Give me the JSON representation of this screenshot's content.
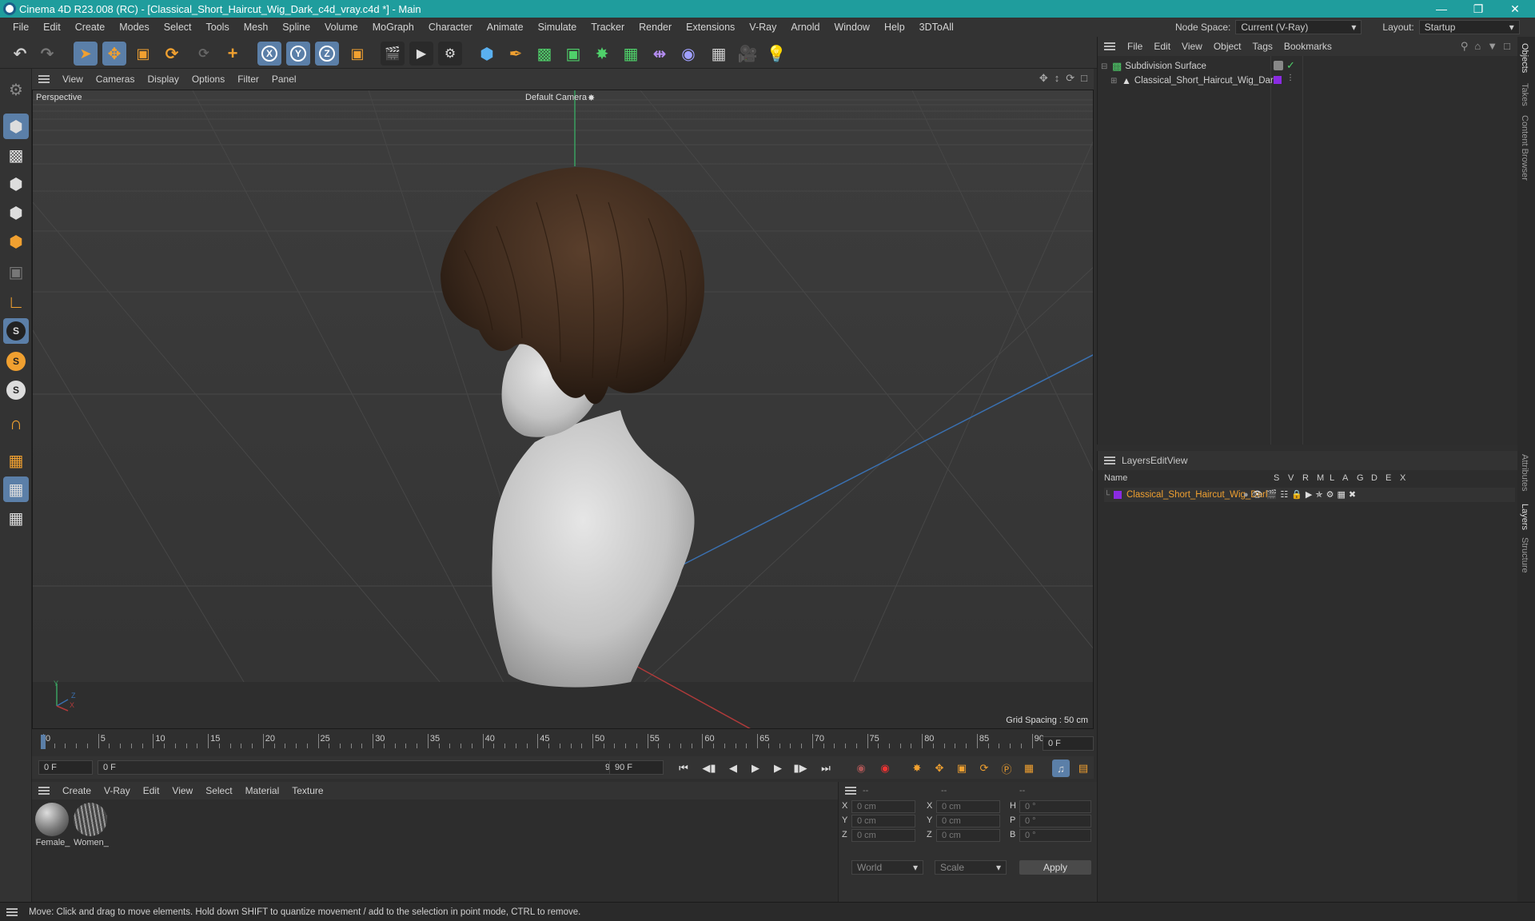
{
  "window": {
    "title": "Cinema 4D R23.008 (RC) - [Classical_Short_Haircut_Wig_Dark_c4d_vray.c4d *] - Main"
  },
  "menu": [
    "File",
    "Edit",
    "Create",
    "Modes",
    "Select",
    "Tools",
    "Mesh",
    "Spline",
    "Volume",
    "MoGraph",
    "Character",
    "Animate",
    "Simulate",
    "Tracker",
    "Render",
    "Extensions",
    "V-Ray",
    "Arnold",
    "Window",
    "Help",
    "3DToAll"
  ],
  "node_space": {
    "label": "Node Space:",
    "value": "Current (V-Ray)"
  },
  "layout": {
    "label": "Layout:",
    "value": "Startup"
  },
  "toolbar_axes": [
    "X",
    "Y",
    "Z"
  ],
  "viewport": {
    "menu": [
      "View",
      "Cameras",
      "Display",
      "Options",
      "Filter",
      "Panel"
    ],
    "name": "Perspective",
    "camera": "Default Camera",
    "grid_spacing": "Grid Spacing : 50 cm",
    "axis_labels": {
      "y": "Y",
      "z": "Z",
      "x": "X"
    }
  },
  "timeline": {
    "ticks": [
      "0",
      "5",
      "10",
      "15",
      "20",
      "25",
      "30",
      "35",
      "40",
      "45",
      "50",
      "55",
      "60",
      "65",
      "70",
      "75",
      "80",
      "85",
      "90"
    ],
    "current_frame": "0 F",
    "start": "0 F",
    "range_start": "0 F",
    "range_end": "90 F",
    "end": "90 F"
  },
  "material_menu": [
    "Create",
    "V-Ray",
    "Edit",
    "View",
    "Select",
    "Material",
    "Texture"
  ],
  "materials": [
    {
      "name": "Female_"
    },
    {
      "name": "Women_"
    }
  ],
  "coords": {
    "header": [
      "--",
      "--",
      "--"
    ],
    "rows": [
      {
        "a": "X",
        "v1": "0 cm",
        "b": "X",
        "v2": "0 cm",
        "c": "H",
        "v3": "0 °"
      },
      {
        "a": "Y",
        "v1": "0 cm",
        "b": "Y",
        "v2": "0 cm",
        "c": "P",
        "v3": "0 °"
      },
      {
        "a": "Z",
        "v1": "0 cm",
        "b": "Z",
        "v2": "0 cm",
        "c": "B",
        "v3": "0 °"
      }
    ],
    "world": "World",
    "scale": "Scale",
    "apply": "Apply"
  },
  "objects": {
    "menu": [
      "File",
      "Edit",
      "View",
      "Object",
      "Tags",
      "Bookmarks"
    ],
    "items": [
      {
        "name": "Subdivision Surface"
      },
      {
        "name": "Classical_Short_Haircut_Wig_Dark"
      }
    ]
  },
  "layers": {
    "menu": [
      "Layers",
      "Edit",
      "View"
    ],
    "columns": [
      "Name",
      "S",
      "V",
      "R",
      "M",
      "L",
      "A",
      "G",
      "D",
      "E",
      "X"
    ],
    "items": [
      {
        "name": "Classical_Short_Haircut_Wig_Dark",
        "color": "#8a2be2"
      }
    ]
  },
  "side_tabs": [
    "Objects",
    "Takes",
    "Content Browser",
    "Attributes",
    "Layers",
    "Structure"
  ],
  "status": "Move: Click and drag to move elements. Hold down SHIFT to quantize movement / add to the selection in point mode, CTRL to remove.",
  "colors": {
    "accent": "#1f9d9d",
    "orange": "#f0a030",
    "highlight": "#5b7fa8",
    "layer_text": "#f0a030"
  }
}
